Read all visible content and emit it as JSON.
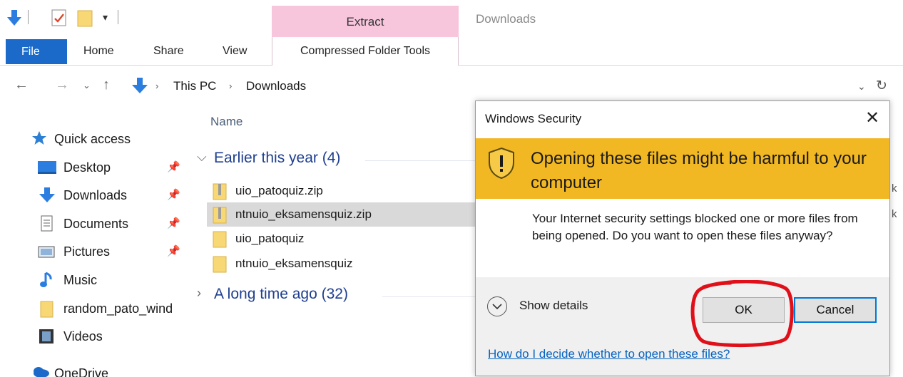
{
  "titlebar": {
    "context_group_label": "Extract",
    "window_title": "Downloads"
  },
  "ribbon": {
    "tabs": [
      {
        "label": "File"
      },
      {
        "label": "Home"
      },
      {
        "label": "Share"
      },
      {
        "label": "View"
      },
      {
        "label": "Compressed Folder Tools"
      }
    ]
  },
  "address": {
    "crumbs": [
      "This PC",
      "Downloads"
    ]
  },
  "navigation": {
    "quick_access_label": "Quick access",
    "items": [
      {
        "label": "Desktop",
        "pinned": true,
        "icon": "desktop-icon"
      },
      {
        "label": "Downloads",
        "pinned": true,
        "icon": "download-icon"
      },
      {
        "label": "Documents",
        "pinned": true,
        "icon": "document-icon"
      },
      {
        "label": "Pictures",
        "pinned": true,
        "icon": "pictures-icon"
      },
      {
        "label": "Music",
        "pinned": false,
        "icon": "music-icon"
      },
      {
        "label": "random_pato_wind",
        "pinned": false,
        "icon": "folder-icon"
      },
      {
        "label": "Videos",
        "pinned": false,
        "icon": "videos-icon"
      }
    ],
    "onedrive_label": "OneDrive"
  },
  "filelist": {
    "column_name": "Name",
    "groups": [
      {
        "label": "Earlier this year (4)",
        "expanded": true
      },
      {
        "label": "A long time ago (32)",
        "expanded": false
      }
    ],
    "files": [
      {
        "name": "uio_patoquiz.zip",
        "type": "zip"
      },
      {
        "name": "ntnuio_eksamensquiz.zip",
        "type": "zip",
        "selected": true
      },
      {
        "name": "uio_patoquiz",
        "type": "folder"
      },
      {
        "name": "ntnuio_eksamensquiz",
        "type": "folder"
      }
    ],
    "truncated_edge_char": "k"
  },
  "dialog": {
    "title": "Windows Security",
    "close_glyph": "✕",
    "warning_heading": "Opening these files might be harmful to your computer",
    "message": "Your Internet security settings blocked one or more files from being opened. Do you want to open these files anyway?",
    "show_details_label": "Show details",
    "ok_label": "OK",
    "cancel_label": "Cancel",
    "help_link": "How do I decide whether to open these files?"
  },
  "colors": {
    "accent": "#1b6ac9",
    "context_tab": "#f7c6dd",
    "warning_band": "#f2b824",
    "link": "#0563c1",
    "annotation": "#e0101a"
  }
}
